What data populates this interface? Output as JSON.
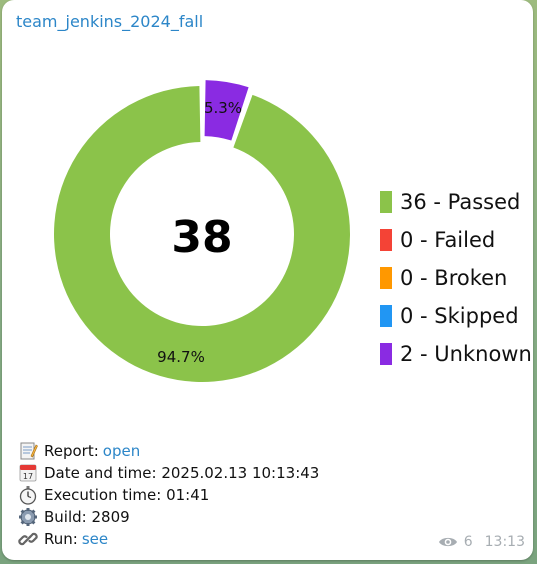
{
  "channel": {
    "name": "team_jenkins_2024_fall"
  },
  "chart_data": {
    "type": "pie",
    "center_label": "38",
    "slices": [
      {
        "name": "Passed",
        "value": 36,
        "percent_label": "94.7%",
        "color": "#8bc34a"
      },
      {
        "name": "Unknown",
        "value": 2,
        "percent_label": "5.3%",
        "color": "#8a2be2"
      }
    ],
    "legend": [
      {
        "text": "36 - Passed",
        "color": "#8bc34a"
      },
      {
        "text": "0 - Failed",
        "color": "#f44336"
      },
      {
        "text": "0 - Broken",
        "color": "#ff9800"
      },
      {
        "text": "0 - Skipped",
        "color": "#2196f3"
      },
      {
        "text": "2 - Unknown",
        "color": "#8a2be2"
      }
    ],
    "legend_position": "right"
  },
  "info": {
    "report_label": "Report: ",
    "report_link": "open",
    "datetime": "Date and time: 2025.02.13 10:13:43",
    "execution": "Execution time: 01:41",
    "build": "Build: 2809",
    "run_label": "Run: ",
    "run_link": "see"
  },
  "meta": {
    "views": "6",
    "time": "13:13"
  },
  "icons": [
    "memo-icon",
    "calendar-icon",
    "stopwatch-icon",
    "gear-icon",
    "link-icon",
    "eye-icon"
  ]
}
